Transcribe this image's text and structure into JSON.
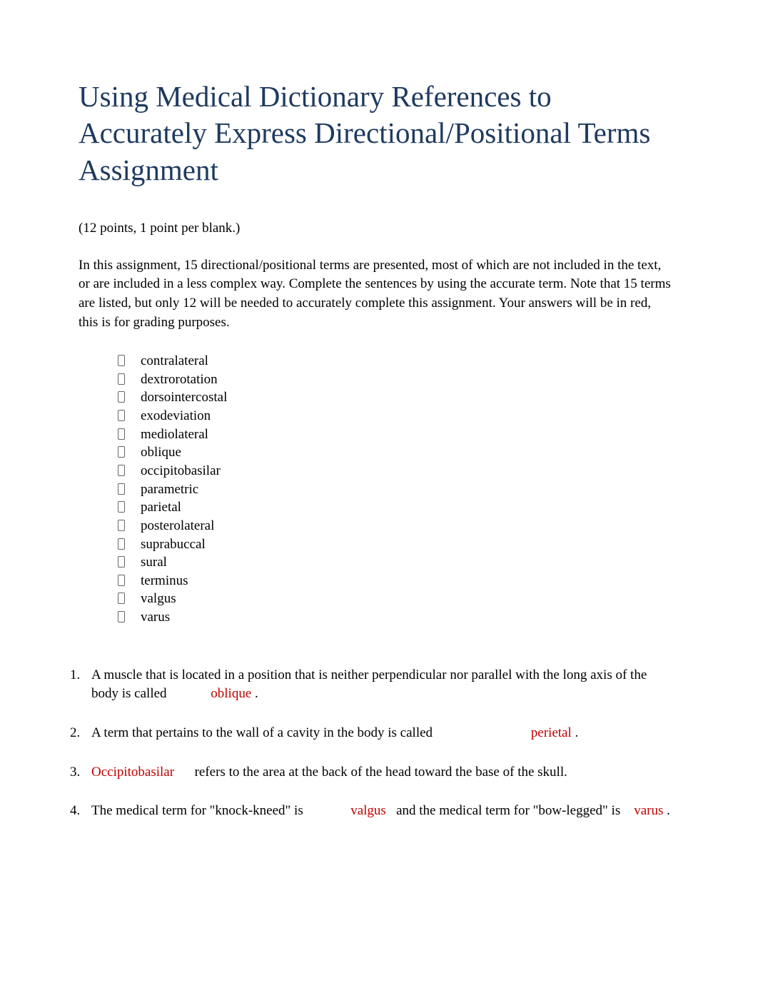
{
  "title": "Using Medical Dictionary References to Accurately Express Directional/Positional Terms Assignment",
  "points_note": "(12 points, 1 point per blank.)",
  "intro": "In this assignment, 15 directional/positional terms are presented, most of which are not included in the text, or are included in a less complex way. Complete the sentences by using the accurate term. Note that 15 terms are listed, but only 12 will be needed to accurately complete this assignment. Your answers will be in red, this is for grading purposes.",
  "terms": [
    "contralateral",
    "dextrorotation",
    "dorsointercostal",
    "exodeviation",
    "mediolateral",
    "oblique",
    "occipitobasilar",
    "parametric",
    "parietal",
    "posterolateral",
    "suprabuccal",
    "sural",
    "terminus",
    "valgus",
    "varus"
  ],
  "questions": {
    "q1": {
      "pre": "A muscle that is located in a position that is neither perpendicular nor parallel with the long axis of the body is called ",
      "answer": "oblique",
      "post": "  ."
    },
    "q2": {
      "pre": "A term that pertains to the wall of a cavity in the body is called ",
      "answer": "perietal",
      "post": "  ."
    },
    "q3": {
      "answer": "Occipitobasilar",
      "post": " refers to the area at the back of the head toward the base of the skull."
    },
    "q4": {
      "pre": "The medical term for \"knock-kneed\" is ",
      "answer1": "valgus",
      "mid": " and the medical term for \"bow-legged\" is ",
      "answer2": "varus",
      "post": "  ."
    }
  }
}
